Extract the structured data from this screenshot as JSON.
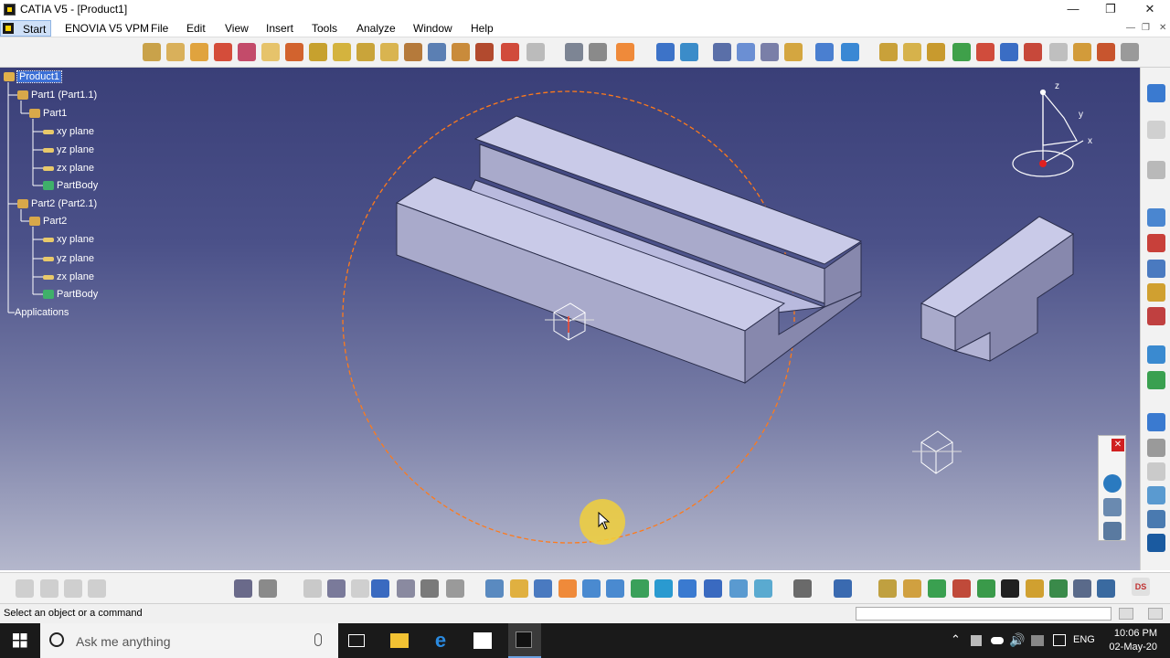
{
  "window": {
    "title": "CATIA V5 - [Product1]"
  },
  "menubar": {
    "start": "Start",
    "items": [
      "ENOVIA V5 VPM",
      "File",
      "Edit",
      "View",
      "Insert",
      "Tools",
      "Analyze",
      "Window",
      "Help"
    ]
  },
  "tree": {
    "root": "Product1",
    "part1_instance": "Part1 (Part1.1)",
    "part1": "Part1",
    "p1_xy": "xy plane",
    "p1_yz": "yz plane",
    "p1_zx": "zx plane",
    "p1_body": "PartBody",
    "part2_instance": "Part2 (Part2.1)",
    "part2": "Part2",
    "p2_xy": "xy plane",
    "p2_yz": "yz plane",
    "p2_zx": "zx plane",
    "p2_body": "PartBody",
    "applications": "Applications"
  },
  "compass": {
    "z": "z",
    "y": "y",
    "x": "x"
  },
  "status": {
    "message": "Select an object or a command"
  },
  "taskbar": {
    "search_placeholder": "Ask me anything",
    "language": "ENG",
    "time": "10:06 PM",
    "date": "02-May-20"
  },
  "colors": {
    "viewport_top": "#3a3f78",
    "viewport_bottom": "#b4b7cc",
    "part_face_top": "#c9cae8",
    "part_face_front": "#a9aacb",
    "part_face_side": "#8788ad",
    "selection_circle": "#ff7a1a",
    "cursor_halo": "#f2d03a"
  }
}
